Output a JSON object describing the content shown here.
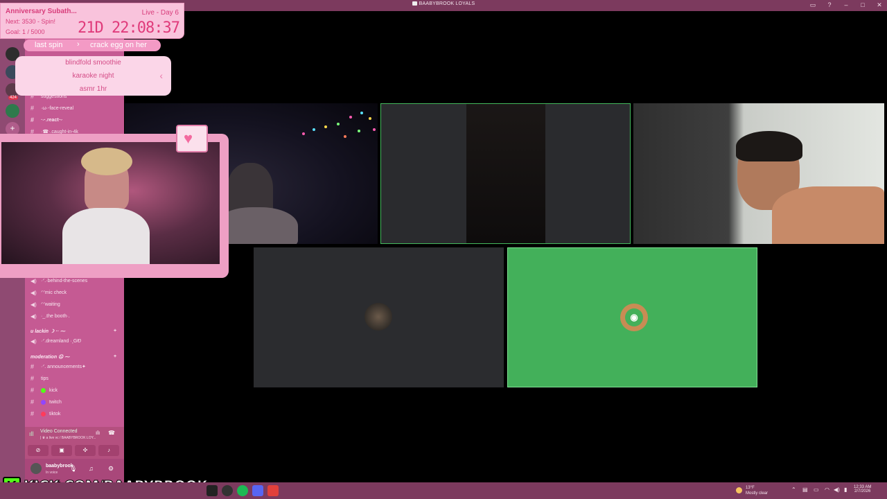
{
  "window": {
    "title": "BAABYBROOK LOYALS"
  },
  "subathon": {
    "title": "Anniversary Subath...",
    "next": "Next: 3530 - Spin!",
    "goal": "Goal: 1 / 5000",
    "day": "Live - Day 6",
    "timer": "21D 22:08:37"
  },
  "spin": {
    "last_label": "last spin",
    "last_value": "crack egg on her",
    "options": [
      "blindfold smoothie",
      "karaoke night",
      "asmr 1hr"
    ]
  },
  "server_badges": {
    "count": "424"
  },
  "channels_top": [
    {
      "name": "suggestions",
      "type": "text"
    },
    {
      "name": "·ω·-face-reveal",
      "type": "text"
    },
    {
      "name": "·-·.react·ᵕ",
      "type": "text"
    },
    {
      "name": "·☎·.caught-in-4k",
      "type": "text"
    }
  ],
  "channels_voice": [
    {
      "name": "·ᐟ.·behind-the-scenes",
      "type": "voice"
    },
    {
      "name": "ᐟᐟmic check",
      "type": "voice"
    },
    {
      "name": "ᐟᐟwaiting",
      "type": "voice"
    },
    {
      "name": "·_.the booth·.",
      "type": "voice"
    }
  ],
  "category_lackin": {
    "name": "u lackin ☽ ·· ⁓",
    "channels": [
      {
        "name": "·ᐟ.dreamland ·˳GᏬ",
        "type": "voice"
      }
    ]
  },
  "category_moderation": {
    "name": "moderation ☹ ⁓",
    "channels": [
      {
        "name": "·ᐟ. announcements✦",
        "type": "text",
        "dot": ""
      },
      {
        "name": "tips",
        "type": "text",
        "dot": ""
      },
      {
        "name": "kick",
        "type": "text",
        "dot": "#53fc18"
      },
      {
        "name": "twitch",
        "type": "text",
        "dot": "#9146ff"
      },
      {
        "name": "tiktok",
        "type": "text",
        "dot": "#ff3b5c"
      }
    ]
  },
  "voice_panel": {
    "status": "Video Connected",
    "location": "| ♛ a live vc / BAABYBROOK LOY...",
    "buttons": [
      "camera-off",
      "screen-share",
      "activities",
      "soundboard"
    ]
  },
  "user": {
    "name": "baabybrook",
    "status": "In voice"
  },
  "kick_banner": {
    "logo": "K",
    "text": "KICK.COM/BAABYBROOK"
  },
  "taskbar": {
    "weather_temp": "13°F",
    "weather_desc": "Mostly clear",
    "time": "12:33 AM",
    "date": "2/7/2026"
  },
  "colors": {
    "accent_pink": "#c55a93",
    "speaking_green": "#43b05a",
    "kick_green": "#53fc18"
  }
}
